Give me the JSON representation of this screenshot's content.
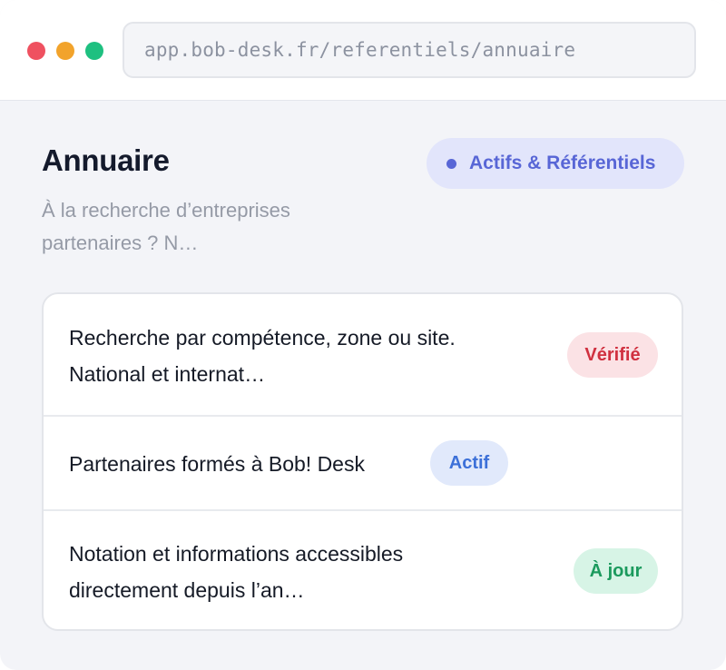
{
  "browser": {
    "url": "app.bob-desk.fr/referentiels/annuaire"
  },
  "header": {
    "title": "Annuaire",
    "subtitle_line1": "À la recherche d’entreprises",
    "subtitle_line2": "partenaires ? N…",
    "category": "Actifs & Référentiels"
  },
  "items": [
    {
      "line1": "Recherche par compétence, zone ou site.",
      "line2": "National et internat…",
      "badge": "Vérifié",
      "badge_color": "#d0303f"
    },
    {
      "line1": "Partenaires formés à Bob! Desk",
      "badge": "Actif",
      "badge_color": "#3c70d8"
    },
    {
      "line1": "Notation et informations accessibles",
      "line2": "directement depuis l’an…",
      "badge": "À jour",
      "badge_color": "#1b9a5d"
    }
  ],
  "colors": {
    "accent": "#5866d6",
    "background": "#f3f4f8"
  }
}
